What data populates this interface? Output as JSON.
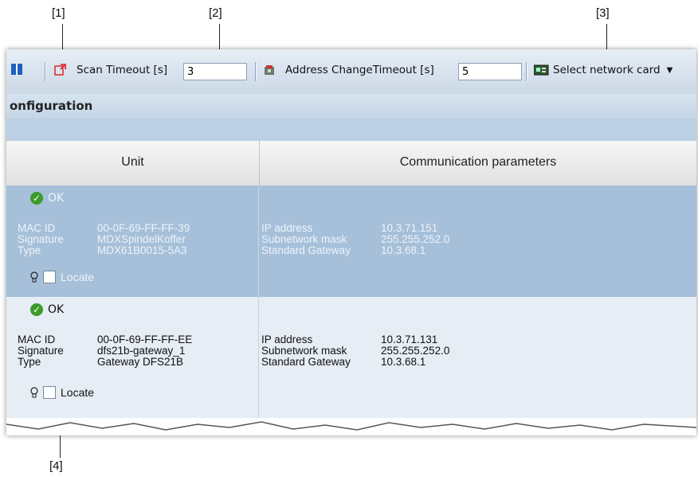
{
  "callouts": [
    "[1]",
    "[2]",
    "[3]",
    "[4]"
  ],
  "toolbar": {
    "scan_timeout_label": "Scan Timeout [s]",
    "scan_timeout_value": "3",
    "address_timeout_label": "Address ChangeTimeout [s]",
    "address_timeout_value": "5",
    "network_card_label": "Select network card"
  },
  "section_title": "onfiguration",
  "columns": {
    "unit": "Unit",
    "comm": "Communication parameters"
  },
  "units": [
    {
      "status": "OK",
      "mac_label": "MAC ID",
      "mac": "00-0F-69-FF-FF-39",
      "sig_label": "Signature",
      "signature": "MDXSpindelKoffer",
      "type_label": "Type",
      "type": "MDX61B0015-5A3",
      "ip_label": "IP address",
      "ip": "10.3.71.151",
      "mask_label": "Subnetwork mask",
      "mask": "255.255.252.0",
      "gw_label": "Standard Gateway",
      "gateway": "10.3.68.1",
      "locate_label": "Locate"
    },
    {
      "status": "OK",
      "mac_label": "MAC ID",
      "mac": "00-0F-69-FF-FF-EE",
      "sig_label": "Signature",
      "signature": "dfs21b-gateway_1",
      "type_label": "Type",
      "type": "Gateway DFS21B",
      "ip_label": "IP address",
      "ip": "10.3.71.131",
      "mask_label": "Subnetwork mask",
      "mask": "255.255.252.0",
      "gw_label": "Standard Gateway",
      "gateway": "10.3.68.1",
      "locate_label": "Locate"
    }
  ],
  "colors": {
    "selected_row": "#a6c0da",
    "normal_row": "#e6edf4",
    "ok": "#3d9b2a"
  }
}
